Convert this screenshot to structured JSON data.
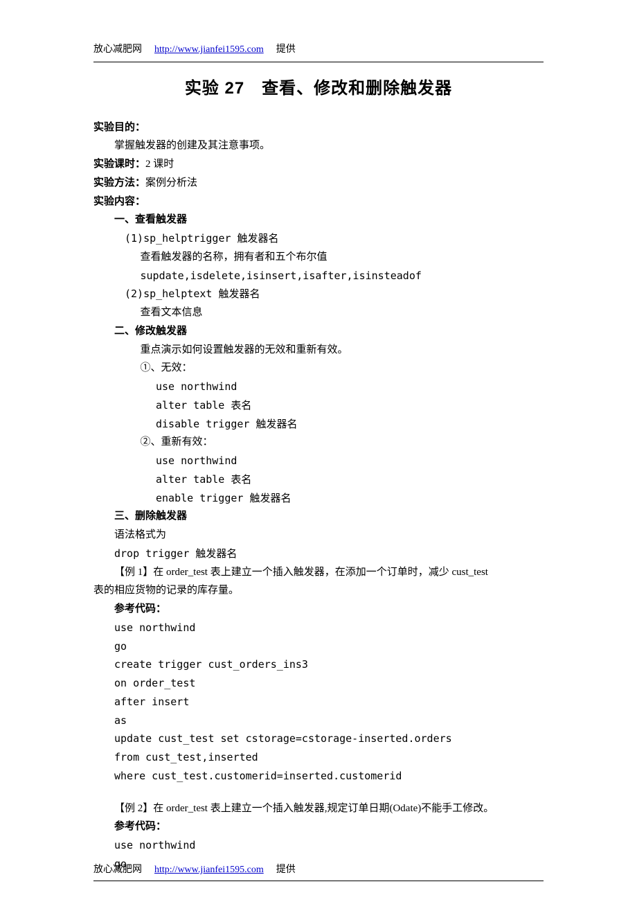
{
  "header": {
    "site_name": "放心减肥网",
    "site_link": "http://www.jianfei1595.com",
    "provided": "提供"
  },
  "title": "实验 27　查看、修改和删除触发器",
  "sections": {
    "purpose_label": "实验目的：",
    "purpose_text": "掌握触发器的创建及其注意事项。",
    "hours_label": "实验课时：",
    "hours_text": "2 课时",
    "method_label": "实验方法：",
    "method_text": "案例分析法",
    "content_label": "实验内容："
  },
  "part1": {
    "heading": "一、查看触发器",
    "item1_num": "(1)sp_helptrigger 触发器名",
    "item1_l1": "查看触发器的名称，拥有者和五个布尔值",
    "item1_l2": "supdate,isdelete,isinsert,isafter,isinsteadof",
    "item2_num": "(2)sp_helptext 触发器名",
    "item2_l1": "查看文本信息"
  },
  "part2": {
    "heading": "二、修改触发器",
    "intro": "重点演示如何设置触发器的无效和重新有效。",
    "a_label": "①、无效：",
    "a_l1": "use northwind",
    "a_l2": "alter table 表名",
    "a_l3": "disable trigger 触发器名",
    "b_label": "②、重新有效：",
    "b_l1": "use northwind",
    "b_l2": "alter table 表名",
    "b_l3": "enable trigger 触发器名"
  },
  "part3": {
    "heading": "三、删除触发器",
    "l1": "语法格式为",
    "l2": "drop trigger 触发器名"
  },
  "ex1": {
    "title": "【例 1】在 order_test 表上建立一个插入触发器，在添加一个订单时，减少 cust_test",
    "title2": "表的相应货物的记录的库存量。",
    "ref_label": "参考代码：",
    "c1": "use northwind",
    "c2": "go",
    "c3": "create trigger cust_orders_ins3",
    "c4": "on order_test",
    "c5": "after insert",
    "c6": "as",
    "c7": "update cust_test set cstorage=cstorage-inserted.orders",
    "c8": "from cust_test,inserted",
    "c9": "where cust_test.customerid=inserted.customerid"
  },
  "ex2": {
    "title": "【例 2】在 order_test 表上建立一个插入触发器,规定订单日期(Odate)不能手工修改。",
    "ref_label": "参考代码：",
    "c1": "use northwind",
    "c2": "go"
  },
  "footer": {
    "site_name": "放心减肥网",
    "site_link": "http://www.jianfei1595.com",
    "provided": "提供"
  }
}
